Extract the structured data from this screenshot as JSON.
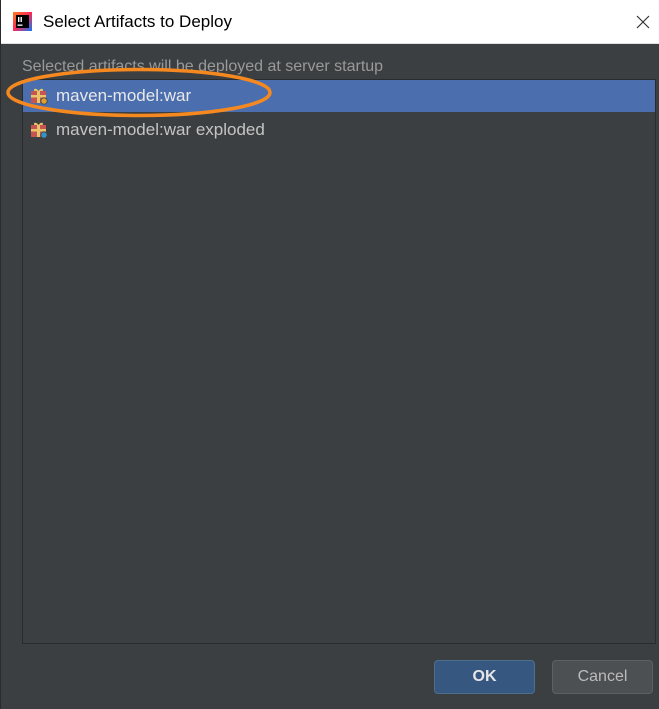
{
  "window": {
    "title": "Select Artifacts to Deploy",
    "app_icon": "intellij-idea-icon",
    "close_glyph": "✕"
  },
  "subtitle": "Selected artifacts will be deployed at server startup",
  "artifacts": [
    {
      "label": "maven-model:war",
      "icon": "artifact-war-icon",
      "selected": true
    },
    {
      "label": "maven-model:war exploded",
      "icon": "artifact-war-icon",
      "selected": false
    }
  ],
  "buttons": {
    "ok_label": "OK",
    "cancel_label": "Cancel"
  },
  "colors": {
    "selection": "#4b6eaf",
    "annotation": "#f5891f",
    "primary_button": "#365880"
  }
}
